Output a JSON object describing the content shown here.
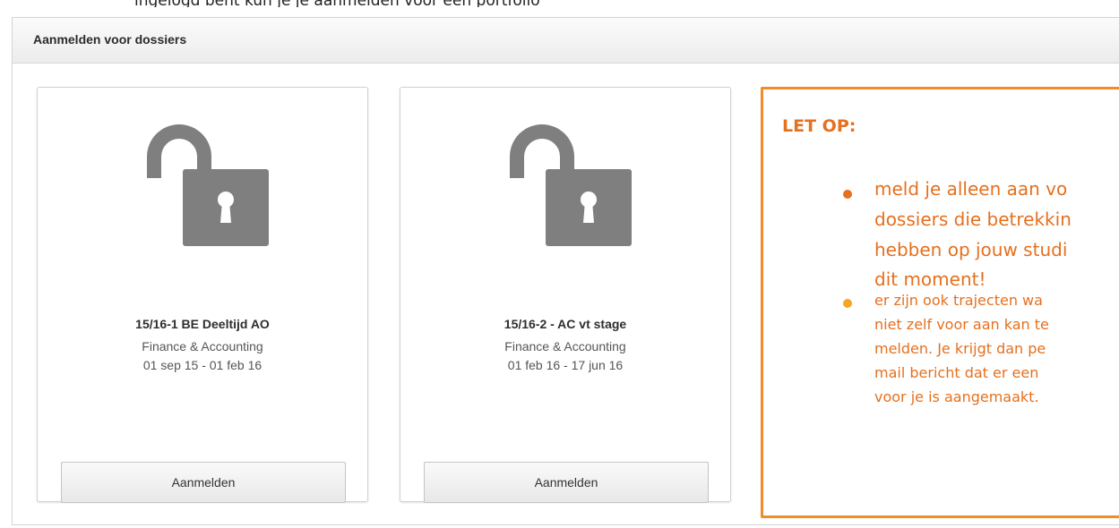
{
  "page_caption": "ingelogd bent kun je je aanmelden voor een portfolio",
  "panel": {
    "title": "Aanmelden voor dossiers"
  },
  "cards": [
    {
      "title": "15/16-1 BE Deeltijd AO",
      "subtitle": "Finance & Accounting",
      "dates": "01 sep 15 - 01 feb 16",
      "button_label": "Aanmelden",
      "icon": "unlocked-padlock-icon"
    },
    {
      "title": "15/16-2 - AC vt stage",
      "subtitle": "Finance & Accounting",
      "dates": "01 feb 16 - 17 jun 16",
      "button_label": "Aanmelden",
      "icon": "unlocked-padlock-icon"
    }
  ],
  "notice": {
    "title": "LET OP:",
    "item1_lines": [
      "meld je alleen aan vo",
      "dossiers die betrekkin",
      "hebben op jouw studi",
      "dit moment!"
    ],
    "item2_lines": [
      "er zijn ook trajecten wa",
      "niet zelf voor aan kan te",
      "melden. Je krijgt dan pe",
      "mail bericht dat er een",
      "voor je is aangemaakt."
    ]
  },
  "colors": {
    "accent_orange": "#e5701e",
    "border_orange": "#f28c28",
    "bullet_yellow": "#f5a623",
    "icon_gray": "#7f7f7f"
  }
}
